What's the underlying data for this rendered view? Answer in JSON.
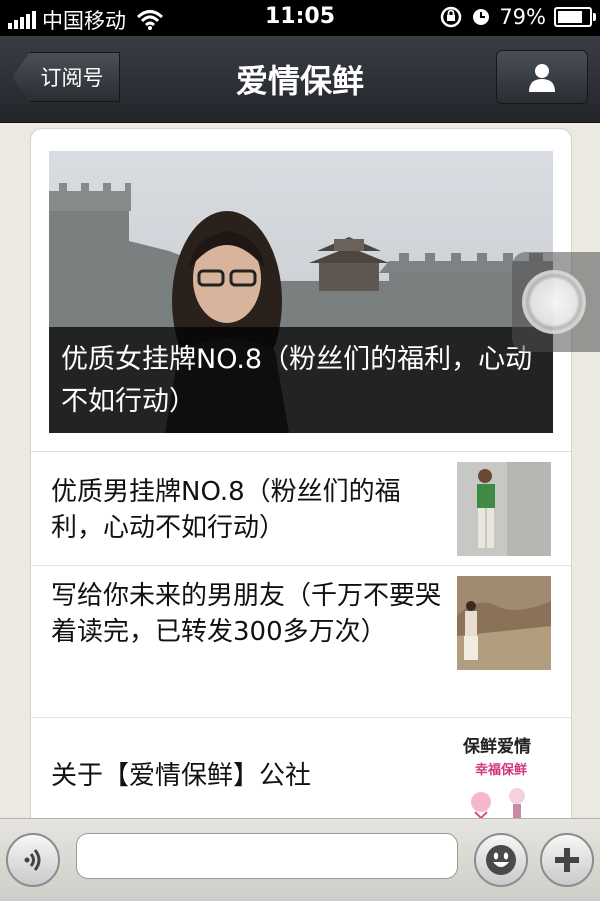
{
  "status_bar": {
    "carrier": "中国移动",
    "time": "11:05",
    "battery": "79%",
    "battery_level": 0.79
  },
  "nav": {
    "back_label": "订阅号",
    "title": "爱情保鲜",
    "profile_icon": "person-icon"
  },
  "hero": {
    "caption": "优质女挂牌NO.8（粉丝们的福利，心动不如行动）"
  },
  "articles": [
    {
      "title": "优质男挂牌NO.8（粉丝们的福利，心动不如行动）"
    },
    {
      "title": "写给你未来的男朋友（千万不要哭着读完，已转发300多万次）"
    },
    {
      "title": "关于【爱情保鲜】公社"
    }
  ],
  "thumb_logo": {
    "line1": "保鲜爱情",
    "line2": "幸福保鲜"
  },
  "input_bar": {
    "placeholder": "",
    "icons": [
      "voice-icon",
      "emoji-icon",
      "plus-icon"
    ]
  }
}
